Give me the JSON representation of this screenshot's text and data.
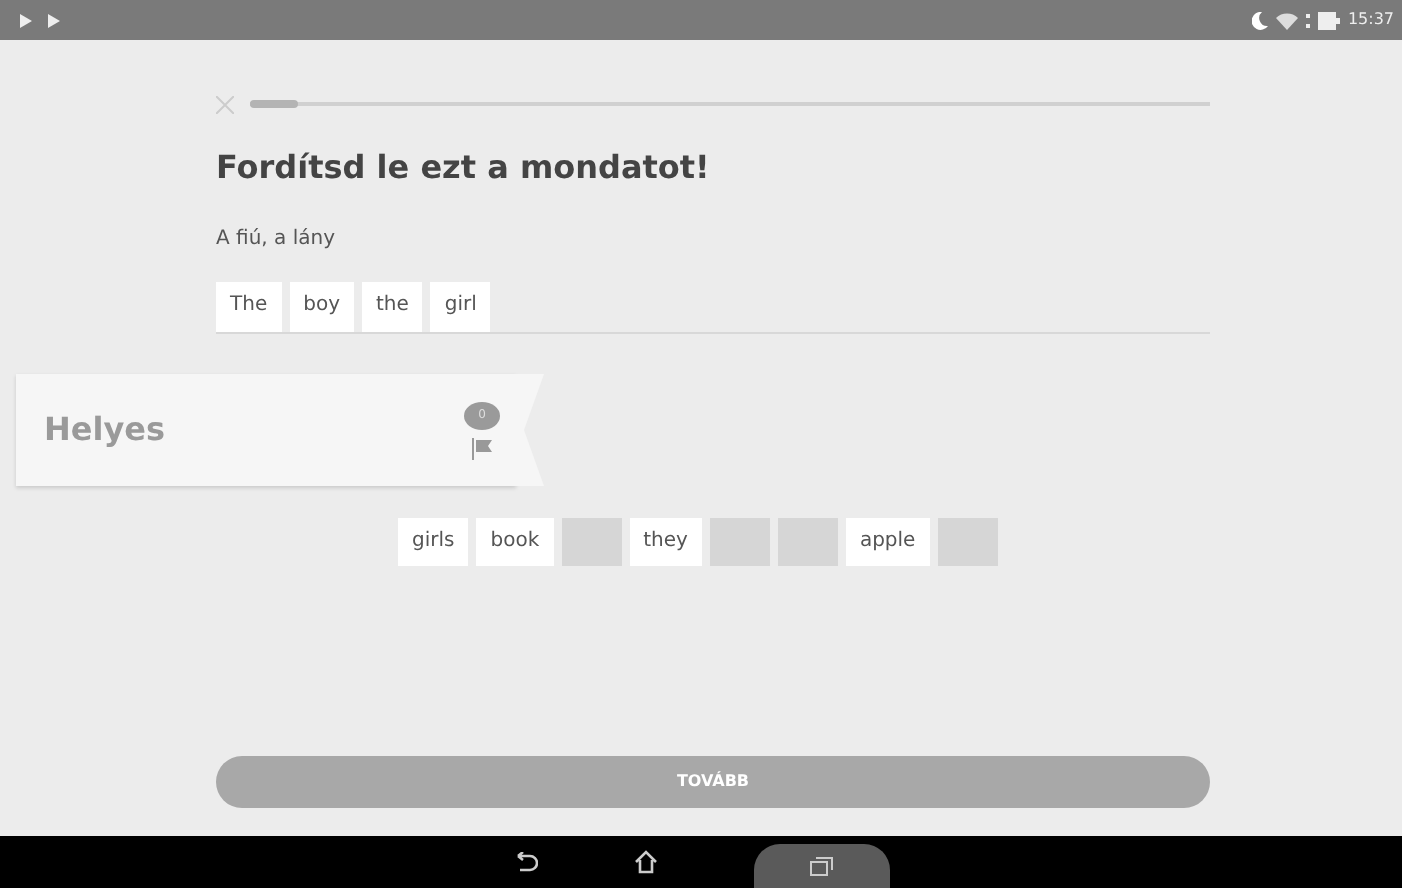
{
  "status_bar": {
    "time": "15:37"
  },
  "progress": {
    "level": 0.05
  },
  "title": "Fordítsd le ezt a mondatot!",
  "prompt": "A fiú, a lány",
  "answer_words": [
    "The",
    "boy",
    "the",
    "girl"
  ],
  "feedback": {
    "label": "Helyes",
    "comment_count": "0"
  },
  "word_bank": [
    {
      "kind": "word",
      "text": "girls"
    },
    {
      "kind": "word",
      "text": "book"
    },
    {
      "kind": "blank"
    },
    {
      "kind": "word",
      "text": "they"
    },
    {
      "kind": "blank"
    },
    {
      "kind": "blank"
    },
    {
      "kind": "word",
      "text": "apple"
    },
    {
      "kind": "blank"
    }
  ],
  "continue_button": {
    "label": "TOVÁBB",
    "disabled": true
  }
}
